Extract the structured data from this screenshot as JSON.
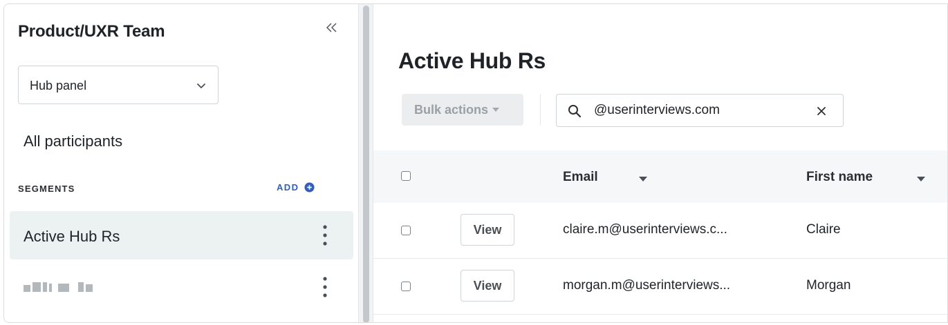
{
  "sidebar": {
    "team_title": "Product/UXR Team",
    "hub_select": {
      "value": "Hub panel"
    },
    "all_participants_label": "All participants",
    "segments_label": "SEGMENTS",
    "add_label": "ADD",
    "segments": [
      {
        "name": "Active Hub Rs",
        "active": true
      },
      {
        "name": "",
        "redacted": true,
        "active": false
      }
    ]
  },
  "main": {
    "page_title": "Active Hub Rs",
    "bulk_actions_label": "Bulk actions",
    "search": {
      "value": "@userinterviews.com"
    },
    "table": {
      "columns": [
        "Email",
        "First name"
      ],
      "rows": [
        {
          "view_label": "View",
          "email": "claire.m@userinterviews.c...",
          "first_name": "Claire"
        },
        {
          "view_label": "View",
          "email": "morgan.m@userinterviews...",
          "first_name": "Morgan"
        }
      ]
    }
  },
  "colors": {
    "accent": "#2f5fbf",
    "active_segment_bg": "#ecf2f1",
    "header_bg": "#f6f7f8"
  },
  "icons": [
    "collapse-left-icon",
    "chevron-down-icon",
    "add-circle-icon",
    "kebab-menu-icon",
    "search-icon",
    "close-icon",
    "caret-down-icon",
    "checkbox-icon"
  ]
}
